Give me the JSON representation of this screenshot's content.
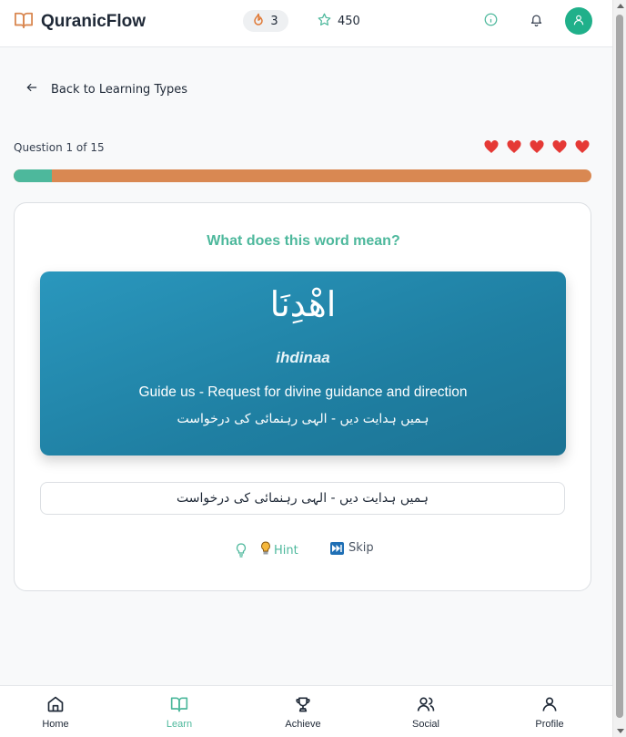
{
  "app": {
    "title": "QuranicFlow",
    "streak": "3",
    "stars": "450"
  },
  "navigation": {
    "back_label": "Back to Learning Types"
  },
  "quiz": {
    "question_counter": "Question 1 of 15",
    "current": 1,
    "total": 15,
    "lives": 5,
    "progress_fraction": 0.0667,
    "prompt": "What does this word mean?"
  },
  "word": {
    "arabic": "اهْدِنَا",
    "transliteration": "ihdinaa",
    "meaning_en": "Guide us - Request for divine guidance and direction",
    "meaning_ur": "ہمیں ہدایت دیں - الہی رہنمائی کی درخواست"
  },
  "answer_option": "ہمیں ہدایت دیں - الہی رہنمائی کی درخواست",
  "actions": {
    "hint_label": "Hint",
    "skip_label": "Skip"
  },
  "bottom_nav": [
    {
      "label": "Home",
      "icon": "home-icon",
      "active": false
    },
    {
      "label": "Learn",
      "icon": "book-icon",
      "active": true
    },
    {
      "label": "Achieve",
      "icon": "trophy-icon",
      "active": false
    },
    {
      "label": "Social",
      "icon": "users-icon",
      "active": false
    },
    {
      "label": "Profile",
      "icon": "user-icon",
      "active": false
    }
  ],
  "colors": {
    "accent": "#4db89c",
    "progress_track": "#d98852",
    "heart": "#e53935",
    "card_gradient_start": "#2a97bd",
    "card_gradient_end": "#1c7394",
    "avatar": "#20b08a"
  }
}
